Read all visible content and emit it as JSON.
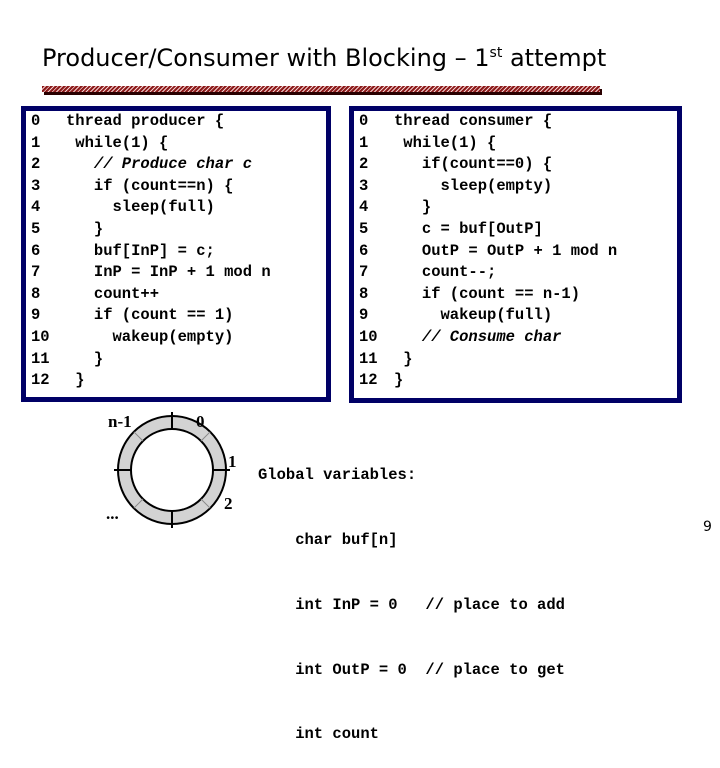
{
  "slide": {
    "title_main": "Producer/Consumer with Blocking – 1",
    "title_sup": "st",
    "title_end": " attempt",
    "page_number": "9"
  },
  "producer": {
    "lines": [
      {
        "num": "0",
        "code": "thread producer {",
        "comment": false
      },
      {
        "num": "1",
        "code": " while(1) {",
        "comment": false
      },
      {
        "num": "2",
        "code": "   // Produce char c",
        "comment": true
      },
      {
        "num": "3",
        "code": "   if (count==n) {",
        "comment": false
      },
      {
        "num": "4",
        "code": "     sleep(full)",
        "comment": false
      },
      {
        "num": "5",
        "code": "   }",
        "comment": false
      },
      {
        "num": "6",
        "code": "   buf[InP] = c;",
        "comment": false
      },
      {
        "num": "7",
        "code": "   InP = InP + 1 mod n",
        "comment": false
      },
      {
        "num": "8",
        "code": "   count++",
        "comment": false
      },
      {
        "num": "9",
        "code": "   if (count == 1)",
        "comment": false
      },
      {
        "num": "10",
        "code": "     wakeup(empty)",
        "comment": false
      },
      {
        "num": "11",
        "code": "   }",
        "comment": false
      },
      {
        "num": "12",
        "code": " }",
        "comment": false
      }
    ]
  },
  "consumer": {
    "lines": [
      {
        "num": "0",
        "code": "thread consumer {",
        "comment": false
      },
      {
        "num": "1",
        "code": " while(1) {",
        "comment": false
      },
      {
        "num": "2",
        "code": "   if(count==0) {",
        "comment": false
      },
      {
        "num": "3",
        "code": "     sleep(empty)",
        "comment": false
      },
      {
        "num": "4",
        "code": "   }",
        "comment": false
      },
      {
        "num": "5",
        "code": "   c = buf[OutP]",
        "comment": false
      },
      {
        "num": "6",
        "code": "   OutP = OutP + 1 mod n",
        "comment": false
      },
      {
        "num": "7",
        "code": "   count--;",
        "comment": false
      },
      {
        "num": "8",
        "code": "   if (count == n-1)",
        "comment": false
      },
      {
        "num": "9",
        "code": "     wakeup(full)",
        "comment": false
      },
      {
        "num": "10",
        "code": "   // Consume char",
        "comment": true
      },
      {
        "num": "11",
        "code": " }",
        "comment": false
      },
      {
        "num": "12",
        "code": "}",
        "comment": false
      }
    ]
  },
  "ring_buffer": {
    "labels": {
      "last": "n-1",
      "zero": "0",
      "one": "1",
      "two": "2",
      "ellipsis": "..."
    },
    "slot_fill": "#d3d3d3"
  },
  "globals": {
    "header": "Global variables:",
    "lines": [
      "    char buf[n]",
      "    int InP = 0   // place to add",
      "    int OutP = 0  // place to get",
      "    int count"
    ]
  }
}
